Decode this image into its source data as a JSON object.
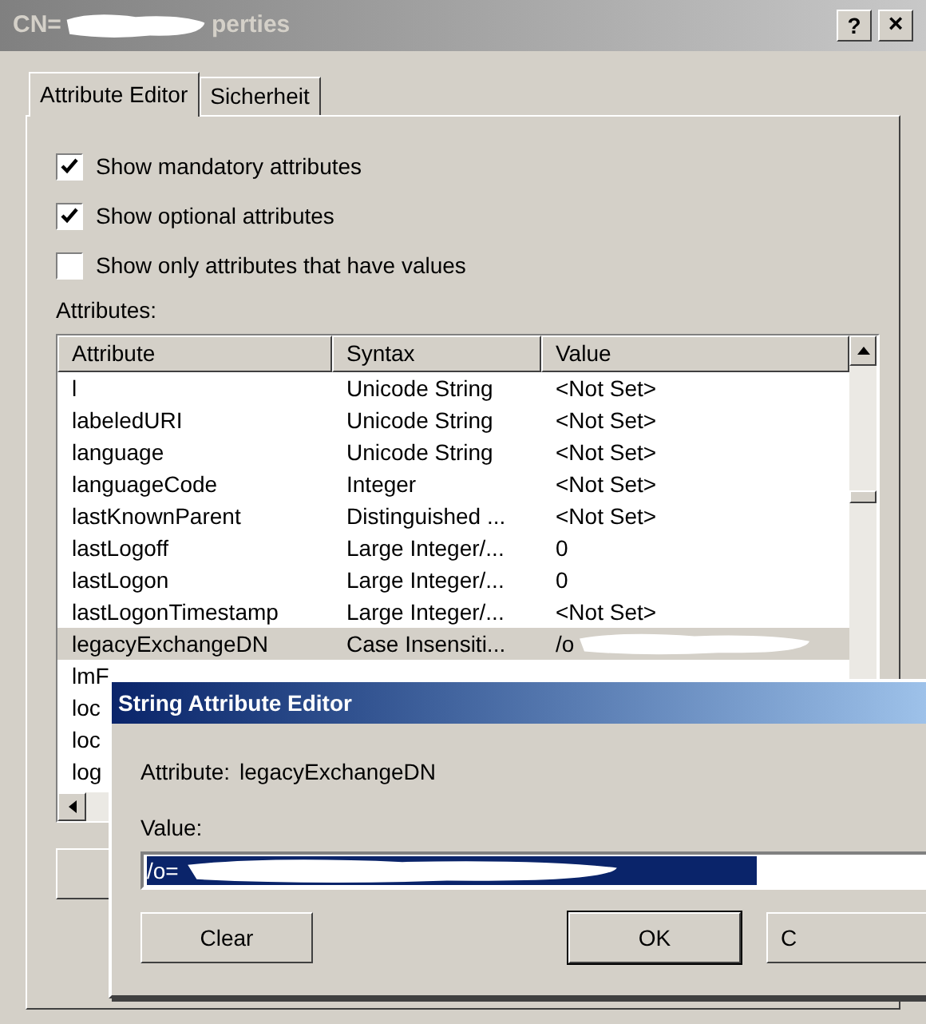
{
  "window": {
    "title_start": "CN=",
    "title_end": "perties",
    "help": "?",
    "close": "×"
  },
  "tabs": [
    {
      "label": "Attribute Editor",
      "selected": true
    },
    {
      "label": "Sicherheit",
      "selected": false
    }
  ],
  "options": [
    {
      "label": "Show mandatory attributes",
      "checked": true
    },
    {
      "label": "Show optional attributes",
      "checked": true
    },
    {
      "label": "Show only attributes that have values",
      "checked": false
    }
  ],
  "attributes_label": "Attributes:",
  "table": {
    "columns": [
      "Attribute",
      "Syntax",
      "Value"
    ],
    "rows": [
      {
        "attribute": "l",
        "syntax": "Unicode String",
        "value": "<Not Set>",
        "selected": false
      },
      {
        "attribute": "labeledURI",
        "syntax": "Unicode String",
        "value": "<Not Set>",
        "selected": false
      },
      {
        "attribute": "language",
        "syntax": "Unicode String",
        "value": "<Not Set>",
        "selected": false
      },
      {
        "attribute": "languageCode",
        "syntax": "Integer",
        "value": "<Not Set>",
        "selected": false
      },
      {
        "attribute": "lastKnownParent",
        "syntax": "Distinguished ...",
        "value": "<Not Set>",
        "selected": false
      },
      {
        "attribute": "lastLogoff",
        "syntax": "Large Integer/...",
        "value": "0",
        "selected": false
      },
      {
        "attribute": "lastLogon",
        "syntax": "Large Integer/...",
        "value": "0",
        "selected": false
      },
      {
        "attribute": "lastLogonTimestamp",
        "syntax": "Large Integer/...",
        "value": "<Not Set>",
        "selected": false
      },
      {
        "attribute": "legacyExchangeDN",
        "syntax": "Case Insensiti...",
        "value": "/o",
        "selected": true
      },
      {
        "attribute": "lmF"
      },
      {
        "attribute": "loc"
      },
      {
        "attribute": "loc"
      },
      {
        "attribute": "log"
      }
    ]
  },
  "editor": {
    "title": "String Attribute Editor",
    "attribute_label": "Attribute:",
    "attribute_name": "legacyExchangeDN",
    "value_label": "Value:",
    "value": "/o=",
    "buttons": [
      {
        "label": "Clear",
        "default": false
      },
      {
        "label": "OK",
        "default": true
      },
      {
        "label": "C",
        "default": false
      }
    ]
  }
}
